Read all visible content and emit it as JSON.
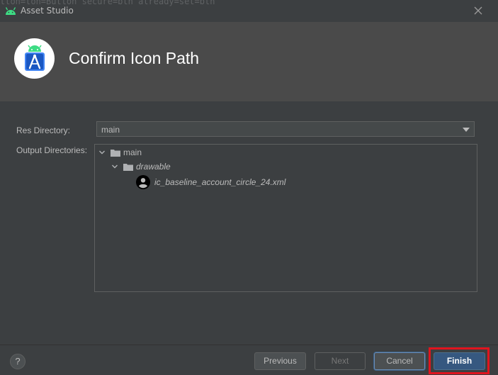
{
  "window": {
    "title": "Asset Studio",
    "background_ghost_text": "tton=ton=Button secure=btn already=set=btn"
  },
  "banner": {
    "heading": "Confirm Icon Path"
  },
  "form": {
    "res_directory_label": "Res Directory:",
    "res_directory_value": "main",
    "output_directories_label": "Output Directories:"
  },
  "tree": {
    "root": "main",
    "folder": "drawable",
    "file": "ic_baseline_account_circle_24.xml"
  },
  "footer": {
    "help_label": "?",
    "previous_label": "Previous",
    "next_label": "Next",
    "cancel_label": "Cancel",
    "finish_label": "Finish"
  },
  "colors": {
    "background": "#3c3f41",
    "banner": "#4a4a4a",
    "finish_button": "#365880",
    "highlight": "#e0141e",
    "android_green": "#3ddc84"
  },
  "icons": [
    "android-icon",
    "close-icon",
    "android-studio-logo",
    "chevron-down-icon",
    "folder-icon",
    "account-circle-icon"
  ]
}
